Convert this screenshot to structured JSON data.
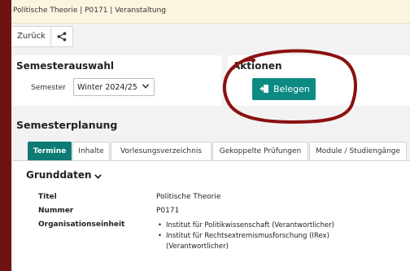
{
  "header": {
    "breadcrumb": "Politische Theorie | P0171 | Veranstaltung"
  },
  "toolbar": {
    "back_label": "Zurück",
    "share_icon": "share-icon"
  },
  "semester_card": {
    "title": "Semesterauswahl",
    "semester_label": "Semester",
    "semester_value": "Winter 2024/25"
  },
  "actions_card": {
    "title": "Aktionen",
    "belegen_label": "Belegen"
  },
  "planning": {
    "title": "Semesterplanung",
    "tabs": [
      {
        "label": "Termine",
        "active": true
      },
      {
        "label": "Inhalte",
        "active": false
      },
      {
        "label": "Vorlesungsverzeichnis",
        "active": false
      },
      {
        "label": "Gekoppelte Prüfungen",
        "active": false
      },
      {
        "label": "Module / Studiengänge",
        "active": false
      }
    ]
  },
  "grunddaten": {
    "title": "Grunddaten",
    "rows": [
      {
        "label": "Titel",
        "value": "Politische Theorie"
      },
      {
        "label": "Nummer",
        "value": "P0171"
      },
      {
        "label": "Organisationseinheit",
        "items": [
          "Institut für Politikwissenschaft (Verantwortlicher)",
          "Institut für Rechtsextremismusforschung (IRex)",
          "(Verantwortlicher)"
        ]
      }
    ]
  },
  "colors": {
    "accent": "#0d8b83",
    "frame": "#6e1212",
    "annotation": "#8b1010",
    "header_bg": "#fbf5df"
  }
}
